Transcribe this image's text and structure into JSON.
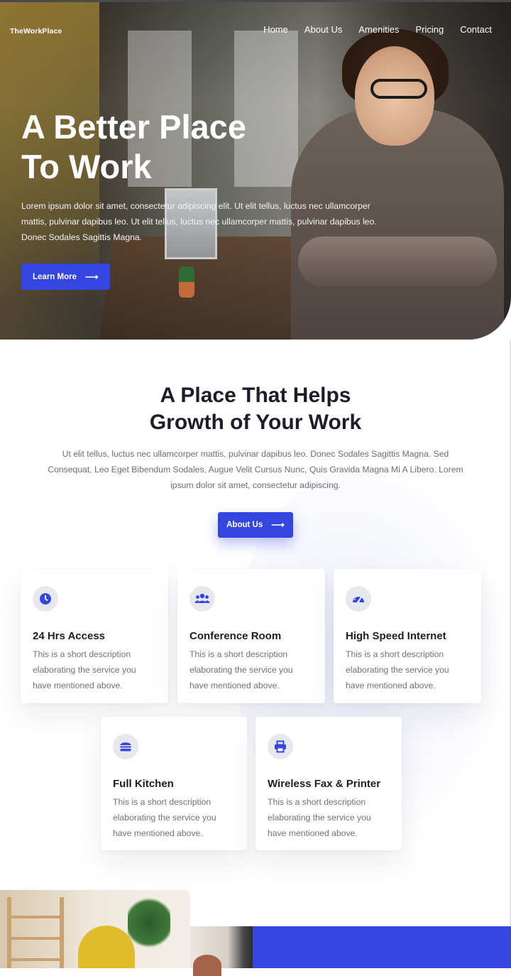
{
  "brand": {
    "logo": "TheWorkPlace"
  },
  "nav": {
    "items": [
      {
        "label": "Home"
      },
      {
        "label": "About Us"
      },
      {
        "label": "Amenities"
      },
      {
        "label": "Pricing"
      },
      {
        "label": "Contact"
      }
    ]
  },
  "hero": {
    "title_line1": "A Better Place",
    "title_line2": "To Work",
    "text": "Lorem ipsum dolor sit amet, consectetur adipiscing elit. Ut elit tellus, luctus nec ullamcorper mattis, pulvinar dapibus leo. Ut elit tellus, luctus nec ullamcorper mattis, pulvinar dapibus leo. Donec Sodales Sagittis Magna.",
    "button_label": "Learn More",
    "button_icon": "arrow-right-icon"
  },
  "intro": {
    "title_line1": "A Place That Helps",
    "title_line2": "Growth of Your Work",
    "text": "Ut elit tellus, luctus nec ullamcorper mattis, pulvinar dapibus leo. Donec Sodales Sagittis Magna. Sed Consequat, Leo Eget Bibendum Sodales, Augue Velit Cursus Nunc, Quis Gravida Magna Mi A Libero. Lorem ipsum dolor sit amet, consectetur adipiscing.",
    "button_label": "About Us",
    "button_icon": "arrow-right-icon"
  },
  "services": [
    {
      "icon": "clock-icon",
      "title": "24 Hrs Access",
      "description": "This is a short description elaborating the service you have mentioned above."
    },
    {
      "icon": "users-icon",
      "title": "Conference Room",
      "description": "This is a short description elaborating the service you have mentioned above."
    },
    {
      "icon": "speedometer-icon",
      "title": "High Speed Internet",
      "description": "This is a short description elaborating the service you have mentioned above."
    },
    {
      "icon": "burger-icon",
      "title": "Full Kitchen",
      "description": "This is a short description elaborating the service you have mentioned above."
    },
    {
      "icon": "printer-icon",
      "title": "Wireless Fax & Printer",
      "description": "This is a short description elaborating the service you have mentioned above."
    }
  ],
  "colors": {
    "accent": "#3546e0",
    "heading": "#1d1d29",
    "body_text": "#6c6c7a",
    "icon_bg": "#e7e8ee"
  }
}
